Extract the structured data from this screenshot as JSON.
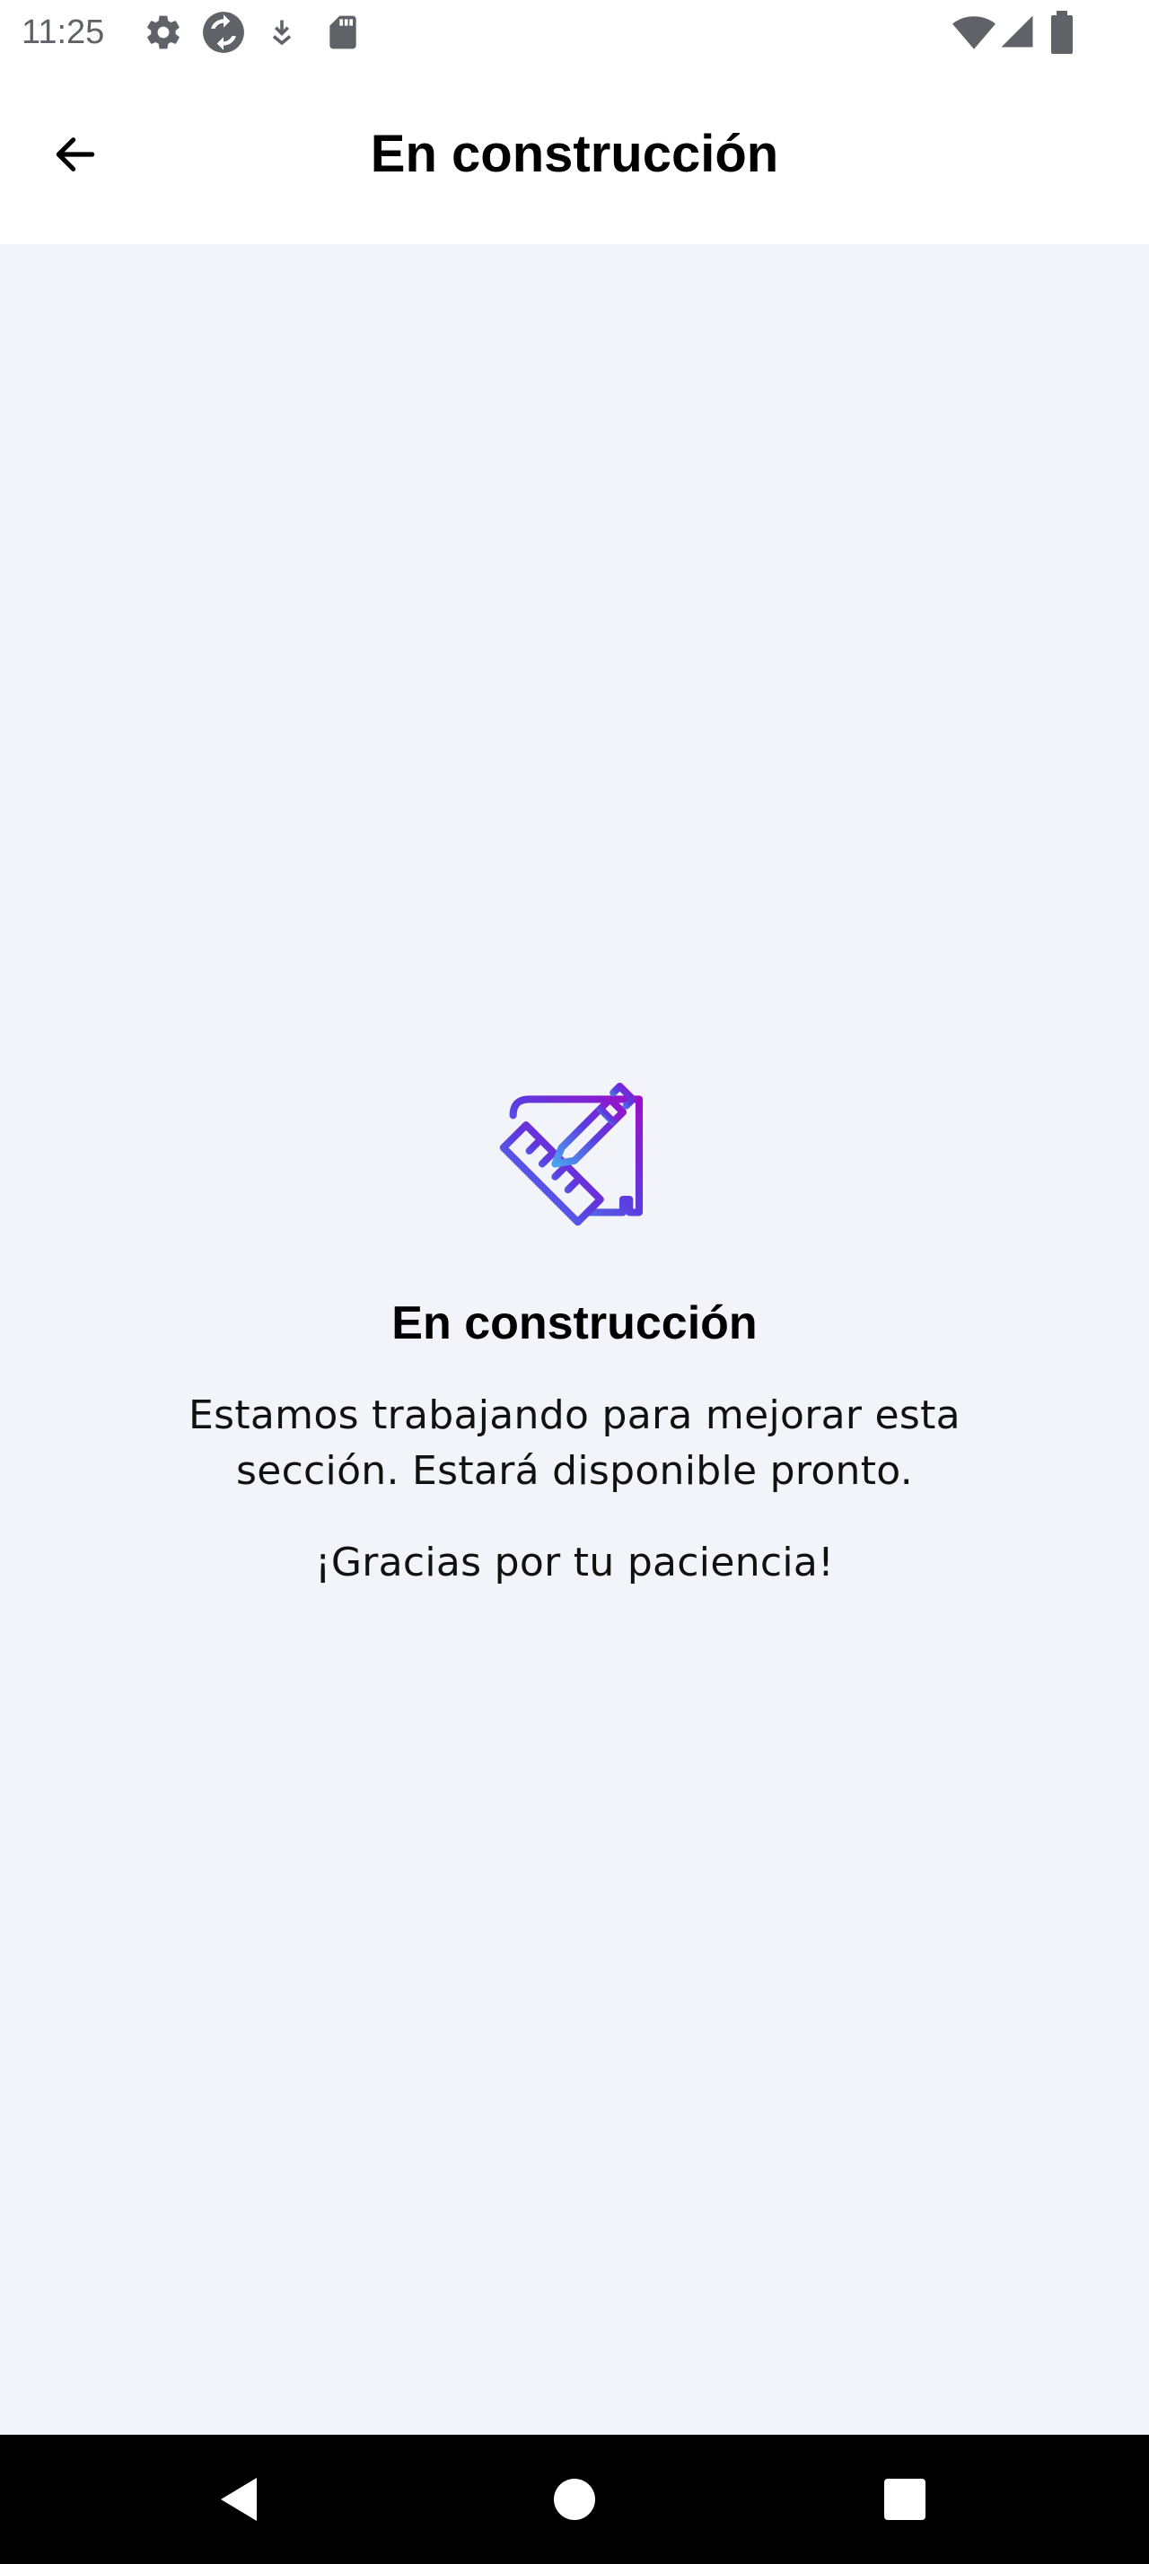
{
  "status_bar": {
    "time": "11:25",
    "left_icons": [
      "settings-icon",
      "sync-icon",
      "download-icon",
      "sd-card-icon"
    ],
    "right_icons": [
      "wifi-icon",
      "signal-icon",
      "battery-icon"
    ]
  },
  "app_bar": {
    "title": "En construcción",
    "back_icon": "arrow-left-icon"
  },
  "empty_state": {
    "illustration": "ruler-pencil-icon",
    "title": "En construcción",
    "message": "Estamos trabajando para mejorar esta sección. Estará disponible pronto.",
    "thanks": "¡Gracias por tu paciencia!"
  },
  "nav_bar": {
    "buttons": [
      "back-triangle-icon",
      "home-circle-icon",
      "recents-square-icon"
    ]
  },
  "colors": {
    "content_background": "#f3f4f9",
    "illustration_gradient_start": "#4aa3f0",
    "illustration_gradient_mid": "#5b3ce0",
    "illustration_gradient_end": "#9b10c8",
    "nav_bar_background": "#000000"
  }
}
